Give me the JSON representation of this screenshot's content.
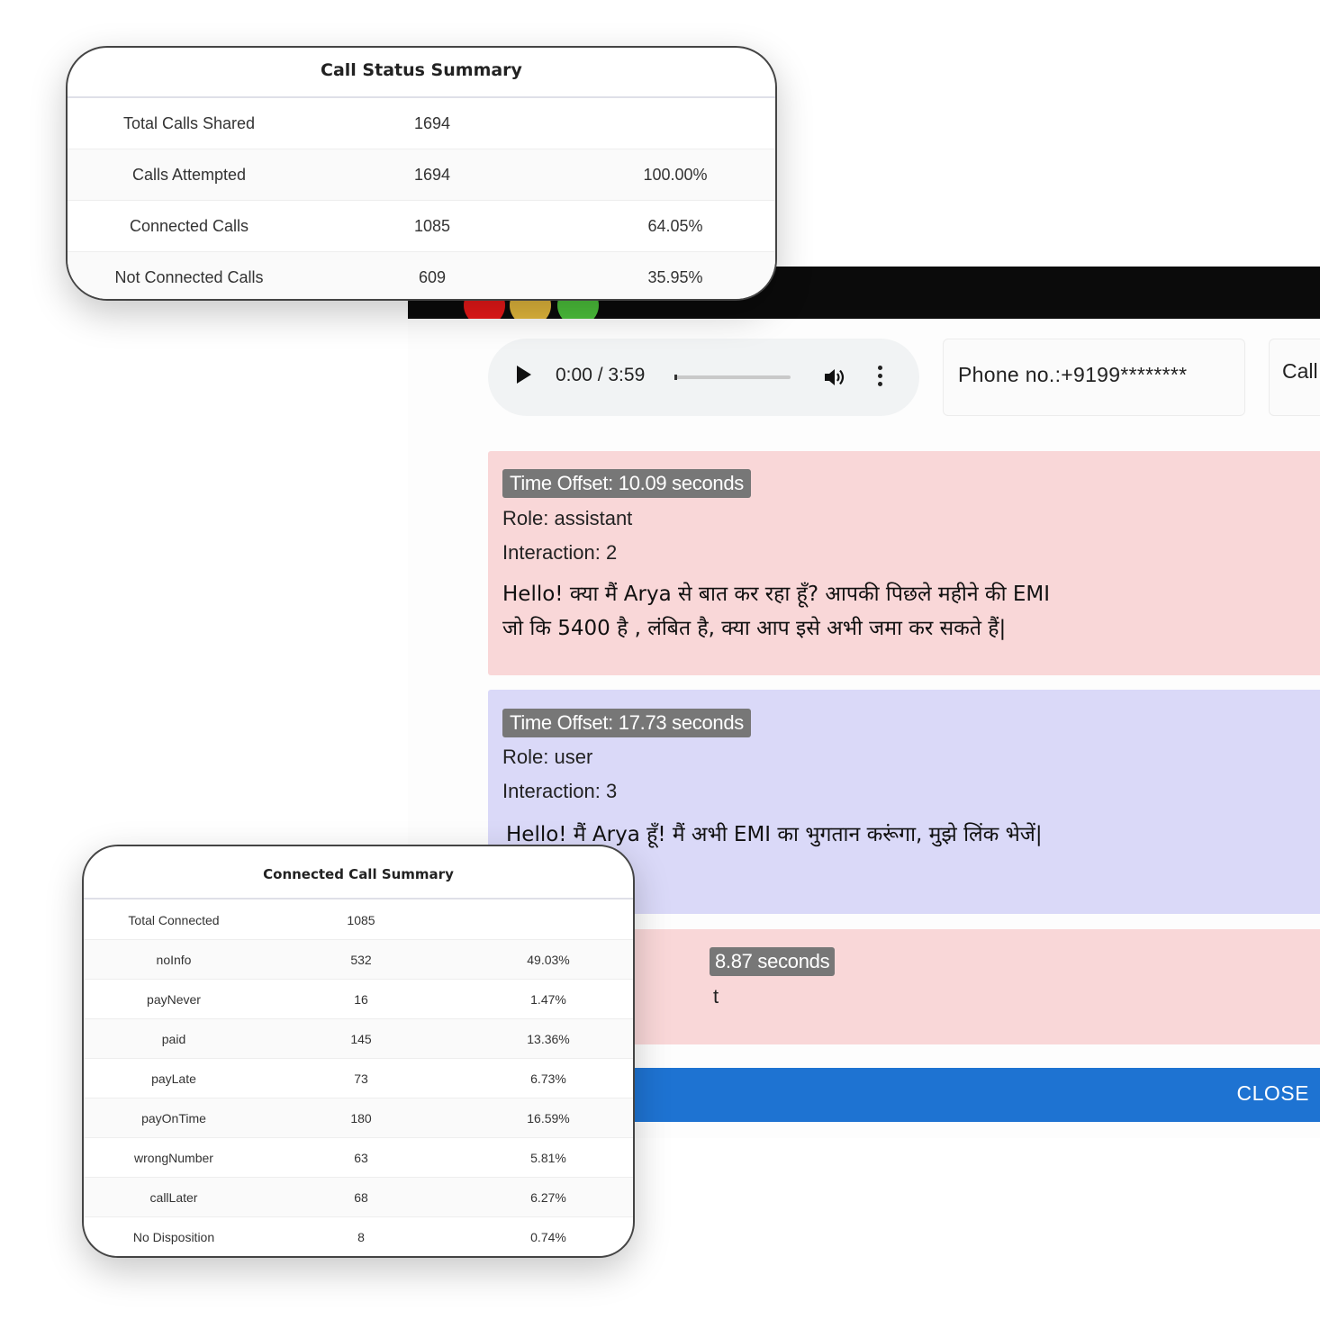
{
  "player": {
    "time": "0:00 / 3:59",
    "progress_fraction": 0.0
  },
  "phone": {
    "label": "Phone no.:+9199********"
  },
  "call_card": {
    "label": "Call"
  },
  "messages": [
    {
      "role_type": "assistant",
      "offset": "Time Offset: 10.09 seconds",
      "role": "Role: assistant",
      "interaction": "Interaction: 2",
      "text_line1": "Hello! क्या मैं Arya से बात कर रहा हूँ? आपकी पिछले महीने की EMI",
      "text_line2": "जो कि 5400 है , लंबित है, क्या आप इसे अभी जमा कर सकते हैं|"
    },
    {
      "role_type": "user",
      "offset": "Time Offset: 17.73 seconds",
      "role": "Role: user",
      "interaction": "Interaction: 3",
      "text_line1": "Hello! मैं Arya हूँ! मैं अभी EMI का भुगतान करूंगा, मुझे लिंक भेजें|"
    },
    {
      "role_type": "assistant",
      "offset_visible": "8.87 seconds",
      "role_visible": "t"
    }
  ],
  "close_button": {
    "label": "CLOSE"
  },
  "call_status_summary": {
    "title": "Call Status Summary",
    "rows": [
      {
        "label": "Total Calls Shared",
        "count": "1694",
        "percent": ""
      },
      {
        "label": "Calls Attempted",
        "count": "1694",
        "percent": "100.00%"
      },
      {
        "label": "Connected Calls",
        "count": "1085",
        "percent": "64.05%"
      },
      {
        "label": "Not Connected Calls",
        "count": "609",
        "percent": "35.95%"
      }
    ]
  },
  "connected_call_summary": {
    "title": "Connected Call Summary",
    "rows": [
      {
        "label": "Total Connected",
        "count": "1085",
        "percent": ""
      },
      {
        "label": "noInfo",
        "count": "532",
        "percent": "49.03%"
      },
      {
        "label": "payNever",
        "count": "16",
        "percent": "1.47%"
      },
      {
        "label": "paid",
        "count": "145",
        "percent": "13.36%"
      },
      {
        "label": "payLate",
        "count": "73",
        "percent": "6.73%"
      },
      {
        "label": "payOnTime",
        "count": "180",
        "percent": "16.59%"
      },
      {
        "label": "wrongNumber",
        "count": "63",
        "percent": "5.81%"
      },
      {
        "label": "callLater",
        "count": "68",
        "percent": "6.27%"
      },
      {
        "label": "No Disposition",
        "count": "8",
        "percent": "0.74%"
      }
    ]
  },
  "colors": {
    "assistant_bg": "#f9d7d8",
    "user_bg": "#dad9f8",
    "close_bar": "#1e73d2",
    "title_bar": "#0b0b0b",
    "dot_red": "#e81818",
    "dot_yellow": "#e2b73c",
    "dot_green": "#4cc13b"
  }
}
